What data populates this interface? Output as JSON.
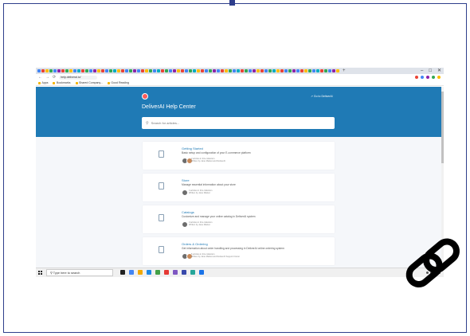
{
  "browser": {
    "tab_favicon_colors": [
      "#4285f4",
      "#ea4335",
      "#fbbc05",
      "#34a853",
      "#4285f4",
      "#8e24aa",
      "#ea4335",
      "#34a853",
      "#fbbc05",
      "#4285f4",
      "#00acc1",
      "#ea4335",
      "#34a853",
      "#4285f4",
      "#8e24aa",
      "#fbbc05",
      "#ea4335",
      "#4285f4",
      "#34a853",
      "#00acc1",
      "#fbbc05",
      "#ea4335",
      "#4285f4",
      "#34a853",
      "#8e24aa",
      "#4285f4",
      "#ea4335",
      "#fbbc05",
      "#34a853",
      "#4285f4",
      "#00acc1",
      "#ea4335",
      "#34a853",
      "#4285f4",
      "#8e24aa",
      "#fbbc05",
      "#ea4335",
      "#4285f4",
      "#34a853",
      "#00acc1",
      "#fbbc05",
      "#ea4335",
      "#4285f4",
      "#34a853",
      "#8e24aa",
      "#4285f4",
      "#ea4335",
      "#fbbc05",
      "#34a853",
      "#4285f4",
      "#00acc1",
      "#ea4335",
      "#34a853",
      "#4285f4",
      "#8e24aa",
      "#fbbc05",
      "#ea4335",
      "#4285f4",
      "#34a853",
      "#00acc1",
      "#fbbc05",
      "#ea4335",
      "#4285f4",
      "#34a853",
      "#8e24aa",
      "#4285f4",
      "#ea4335",
      "#fbbc05",
      "#34a853",
      "#4285f4",
      "#00acc1",
      "#ea4335",
      "#34a853",
      "#4285f4",
      "#8e24aa",
      "#fbbc05"
    ],
    "new_tab": "+",
    "window_controls": {
      "minimize": "–",
      "maximize": "□",
      "close": "✕"
    },
    "nav": {
      "back": "←",
      "forward": "→",
      "reload": "⟳"
    },
    "url": "help.deliverai.io/",
    "extension_colors": [
      "#ea4335",
      "#4285f4",
      "#8e24aa",
      "#34a853",
      "#fbbc05"
    ],
    "bookmarks": [
      "Apps",
      "Bookmarks",
      "Shared Company...",
      "Good Reading"
    ]
  },
  "help_center": {
    "title": "DeliverAI Help Center",
    "goto_link": "Go to DeliverAI",
    "search_placeholder": "Search for articles...",
    "collections": [
      {
        "title": "Getting Started",
        "description": "Basic setup and configuration of your E-commerce platform",
        "articles": "2 articles in this collection",
        "authors": "Written by Jane Market and DeliverAI",
        "avatar_colors": [
          "#6d6d6d",
          "#c98a5a"
        ]
      },
      {
        "title": "Store",
        "description": "Manage essential information about your store",
        "articles": "4 articles in this collection",
        "authors": "Written by Jane Market",
        "avatar_colors": [
          "#6d6d6d"
        ]
      },
      {
        "title": "Catalogs",
        "description": "Customize and manage your online catalog in DeliverAI system",
        "articles": "3 articles in this collection",
        "authors": "Written by Jane Market",
        "avatar_colors": [
          "#6d6d6d"
        ]
      },
      {
        "title": "Orders & Ordering",
        "description": "Get information about order handling and processing in DeliverAI online ordering system",
        "articles": "5 articles in this collection",
        "authors": "Written by Jane Market and DeliverAI Support Owner",
        "avatar_colors": [
          "#6d6d6d",
          "#c98a5a"
        ]
      }
    ],
    "accent_color": "#1f7ab5"
  },
  "taskbar": {
    "search_text": "Type here to search",
    "app_colors": [
      "#222222",
      "#4285f4",
      "#f2a900",
      "#1e88e5",
      "#43a047",
      "#e53935",
      "#7e57c2",
      "#3949ab",
      "#26a69a",
      "#1a73e8"
    ]
  },
  "link_icon": "link-icon"
}
